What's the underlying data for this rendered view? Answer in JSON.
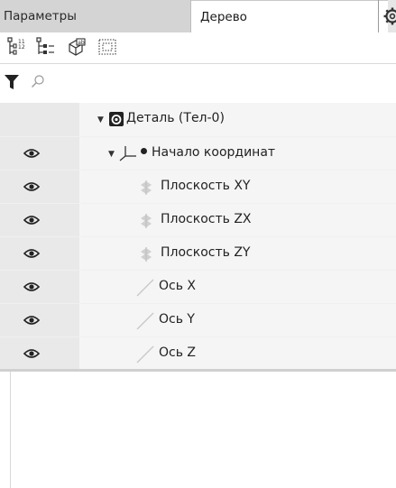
{
  "tabs": [
    {
      "label": "Параметры",
      "active": false
    },
    {
      "label": "Дерево",
      "active": true
    }
  ],
  "toolbar": {
    "buttons": [
      "tree-structure-icon",
      "tree-hierarchy-icon",
      "component-icon",
      "selection-frame-icon"
    ]
  },
  "filter": {
    "search_placeholder": ""
  },
  "tree": {
    "nodes": [
      {
        "label": "Деталь (Тел-0)",
        "icon": "part-icon",
        "level": 0,
        "expanded": true,
        "visible_toggle": false
      },
      {
        "label": "Начало координат",
        "icon": "origin-icon",
        "level": 1,
        "expanded": true,
        "visible_toggle": true
      },
      {
        "label": "Плоскость XY",
        "icon": "plane-icon",
        "level": 2,
        "visible_toggle": true
      },
      {
        "label": "Плоскость ZX",
        "icon": "plane-icon",
        "level": 2,
        "visible_toggle": true
      },
      {
        "label": "Плоскость ZY",
        "icon": "plane-icon",
        "level": 2,
        "visible_toggle": true
      },
      {
        "label": "Ось X",
        "icon": "axis-icon",
        "level": 2,
        "visible_toggle": true
      },
      {
        "label": "Ось Y",
        "icon": "axis-icon",
        "level": 2,
        "visible_toggle": true
      },
      {
        "label": "Ось Z",
        "icon": "axis-icon",
        "level": 2,
        "visible_toggle": true
      }
    ]
  },
  "colors": {
    "tab_inactive": "#d4d4d4",
    "visibility_column": "#e9e9e9",
    "row_bg": "#f5f5f5"
  }
}
